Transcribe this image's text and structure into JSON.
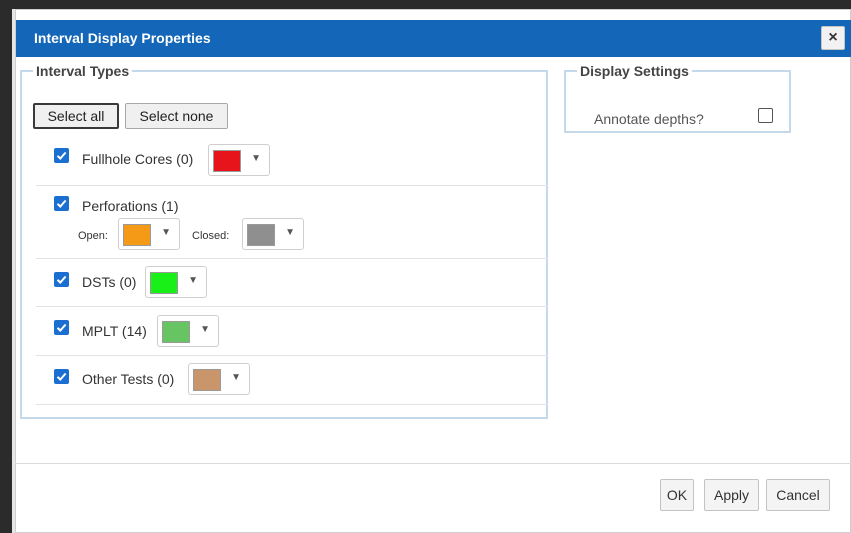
{
  "dialog": {
    "title": "Interval Display Properties",
    "close_symbol": "×"
  },
  "interval_types": {
    "legend": "Interval Types",
    "select_all_label": "Select all",
    "select_none_label": "Select none",
    "items": [
      {
        "label": "Fullhole Cores (0)",
        "checked": true,
        "color": "#e8141b"
      },
      {
        "label": "Perforations (1)",
        "checked": true,
        "open_label": "Open:",
        "open_color": "#f59a16",
        "closed_label": "Closed:",
        "closed_color": "#8f8f8f"
      },
      {
        "label": "DSTs (0)",
        "checked": true,
        "color": "#18f018"
      },
      {
        "label": "MPLT (14)",
        "checked": true,
        "color": "#66c462"
      },
      {
        "label": "Other Tests (0)",
        "checked": true,
        "color": "#c8966a"
      }
    ]
  },
  "display_settings": {
    "legend": "Display Settings",
    "annotate_label": "Annotate depths?",
    "annotate_checked": false
  },
  "footer": {
    "ok_label": "OK",
    "apply_label": "Apply",
    "cancel_label": "Cancel"
  },
  "icons": {
    "checkbox": "checkmark-icon",
    "dropdown": "caret-down-icon",
    "close": "close-icon"
  },
  "colors": {
    "titlebar": "#1366b8",
    "checkbox": "#1a6fd1",
    "fieldset_border": "#c6d9ea"
  }
}
